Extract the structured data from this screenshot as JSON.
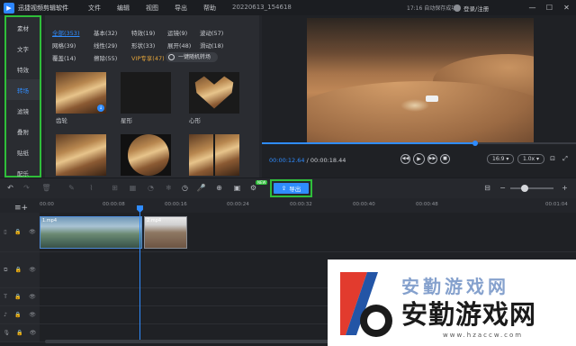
{
  "titlebar": {
    "app_name": "迅捷视频剪辑软件",
    "menu": [
      "文件",
      "编辑",
      "视图",
      "导出",
      "帮助"
    ],
    "project_name": "20220613_154618",
    "autosave": "17:16 自动保存成功",
    "login": "登录/注册"
  },
  "sidebar": {
    "items": [
      {
        "label": "素材"
      },
      {
        "label": "文字"
      },
      {
        "label": "特效"
      },
      {
        "label": "转场"
      },
      {
        "label": "滤镜"
      },
      {
        "label": "叠附"
      },
      {
        "label": "贴纸"
      },
      {
        "label": "配乐"
      }
    ],
    "active_index": 3
  },
  "transitions": {
    "categories": [
      {
        "label": "全部(353)"
      },
      {
        "label": "基本(32)"
      },
      {
        "label": "特效(19)"
      },
      {
        "label": "运镜(9)"
      },
      {
        "label": "波动(57)"
      },
      {
        "label": "网格(39)"
      },
      {
        "label": "线性(29)"
      },
      {
        "label": "形状(33)"
      },
      {
        "label": "展开(48)"
      },
      {
        "label": "滑动(18)"
      },
      {
        "label": "覆盖(14)"
      },
      {
        "label": "擦除(55)"
      },
      {
        "label": "VIP专享(47)"
      }
    ],
    "one_key_label": "一键随机转场",
    "items": [
      {
        "label": "齿轮"
      },
      {
        "label": "星形"
      },
      {
        "label": "心形"
      },
      {
        "label": ""
      },
      {
        "label": ""
      },
      {
        "label": ""
      }
    ]
  },
  "preview": {
    "current_time": "00:00:12.64",
    "total_time": "00:00:18.44",
    "progress": 0.68,
    "ratio": "16:9",
    "speed": "1.0x"
  },
  "toolbar": {
    "export_label": "导出",
    "new_badge": "NEW"
  },
  "ruler": {
    "ticks": [
      "00:00",
      "00:00:08",
      "00:00:16",
      "00:00:24",
      "00:00:32",
      "00:00:40",
      "00:00:48",
      "00:01:04"
    ]
  },
  "timeline": {
    "clip1_label": "1.mp4",
    "clip2_label": "2.mp4"
  },
  "watermark": {
    "line1": "安勤游戏网",
    "line2": "安勤游戏网",
    "url": "www.hzaccw.com"
  }
}
